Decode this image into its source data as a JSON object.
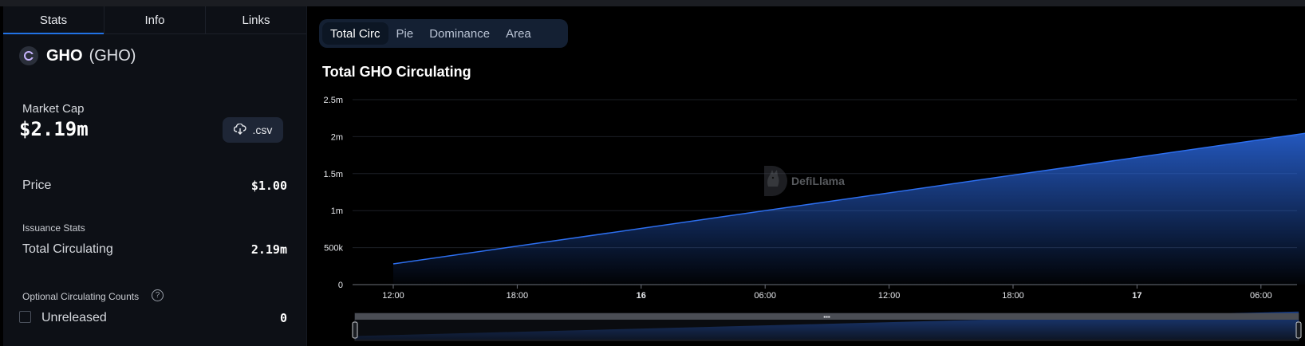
{
  "tabs": [
    "Stats",
    "Info",
    "Links"
  ],
  "coin": {
    "name": "GHO",
    "symbol": "(GHO)"
  },
  "market_cap": {
    "label": "Market Cap",
    "value": "$2.19m"
  },
  "csv_button": ".csv",
  "price": {
    "label": "Price",
    "value": "$1.00"
  },
  "issuance": {
    "section": "Issuance Stats",
    "label": "Total Circulating",
    "value": "2.19m"
  },
  "optional": {
    "section": "Optional Circulating Counts",
    "unreleased_label": "Unreleased",
    "unreleased_value": "0",
    "help": "?"
  },
  "chart_tabs": [
    "Total Circ",
    "Pie",
    "Dominance",
    "Area"
  ],
  "watermark": "DefiLlama",
  "colors": {
    "accent": "#2172e5",
    "series": "#2d6ff0"
  },
  "chart_data": {
    "type": "area",
    "title": "Total GHO Circulating",
    "x_ticks": [
      "12:00",
      "18:00",
      "16",
      "06:00",
      "12:00",
      "18:00",
      "17",
      "06:00"
    ],
    "x_ticks_bold": [
      false,
      false,
      true,
      false,
      false,
      false,
      true,
      false
    ],
    "y_ticks": [
      "0",
      "500k",
      "1m",
      "1.5m",
      "2m",
      "2.5m"
    ],
    "y_values": [
      0,
      500000,
      1000000,
      1500000,
      2000000,
      2500000
    ],
    "ylim": [
      0,
      2500000
    ],
    "x_hours": [
      10,
      58
    ],
    "series": [
      {
        "points": [
          [
            10,
            280000
          ],
          [
            58,
            2200000
          ]
        ]
      }
    ],
    "grid": true,
    "legend": "none"
  }
}
